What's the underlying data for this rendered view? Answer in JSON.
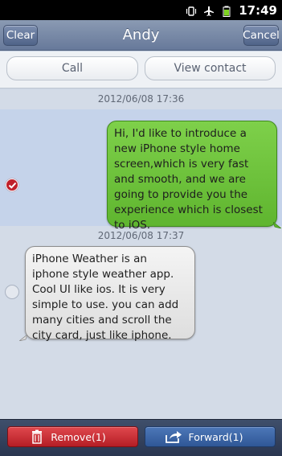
{
  "status_bar": {
    "time": "17:49",
    "icons": [
      "vibrate-icon",
      "airplane-mode-icon",
      "battery-icon"
    ]
  },
  "header": {
    "title": "Andy",
    "left_button": "Clear",
    "right_button": "Cancel"
  },
  "actions": {
    "call": "Call",
    "view_contact": "View contact"
  },
  "messages": [
    {
      "timestamp": "2012/06/08 17:36",
      "direction": "outgoing",
      "selected": true,
      "text": "Hi, I'd like to introduce a\nnew iPhone style home\nscreen,which is very fast\nand smooth, and we are\ngoing to provide you the\nexperience which is closest\nto iOS."
    },
    {
      "timestamp": "2012/06/08 17:37",
      "direction": "incoming",
      "selected": false,
      "text": "iPhone Weather is an\niphone style weather app.\nCool UI like ios. It is very\nsimple to use. you can add\nmany cities and scroll the\ncity card, just like iphone."
    }
  ],
  "bottom_bar": {
    "remove": "Remove(1)",
    "forward": "Forward(1)"
  },
  "colors": {
    "outgoing_bubble": "#6cc23b",
    "incoming_bubble": "#e8e8e8",
    "remove_button": "#c62a31",
    "forward_button": "#3d66a6",
    "title_bar": "#7a8ba8"
  }
}
